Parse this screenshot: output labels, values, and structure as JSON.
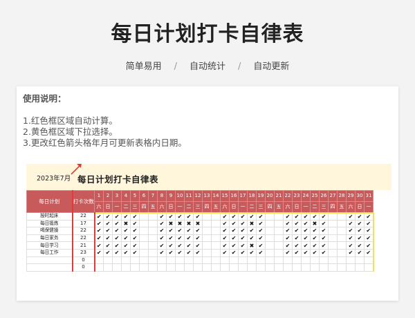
{
  "page": {
    "title": "每日计划打卡自律表",
    "features": [
      "简单易用",
      "自动统计",
      "自动更新"
    ],
    "separator": "/"
  },
  "instructions": {
    "heading": "使用说明：",
    "lines": [
      "1.红色框区域自动计算。",
      "2.黄色框区域下拉选择。",
      "3.更改红色箭头格年月可更新表格内日期。"
    ]
  },
  "sheet": {
    "year_month": "2023年7月",
    "title": "每日计划打卡自律表",
    "col_plan": "每日计划",
    "col_count": "打卡次数",
    "days": [
      "1",
      "2",
      "3",
      "4",
      "5",
      "6",
      "7",
      "8",
      "9",
      "10",
      "11",
      "12",
      "13",
      "14",
      "15",
      "16",
      "17",
      "18",
      "19",
      "20",
      "21",
      "22",
      "23",
      "24",
      "25",
      "26",
      "27",
      "28",
      "29",
      "30",
      "31"
    ],
    "weekdays": [
      "六",
      "日",
      "一",
      "二",
      "三",
      "四",
      "五",
      "六",
      "日",
      "一",
      "二",
      "三",
      "四",
      "五",
      "六",
      "日",
      "一",
      "二",
      "三",
      "四",
      "五",
      "六",
      "日",
      "一",
      "二",
      "三",
      "四",
      "五",
      "六",
      "日",
      "一"
    ],
    "rows": [
      {
        "name": "按时起床",
        "count": "22",
        "marks": "✔,✔,✔,✔,✔,,,✔,✔,✔,✔,✔,,,✔,✔,✔,✔,✔,,,✔,✔,✔,✔,✔,,,✔,✔,✔"
      },
      {
        "name": "每日锻炼",
        "count": "17",
        "marks": "✔,✔,✔,✖,✔,,,✔,✖,✖,✖,✖,,,✔,✔,✔,✖,✔,,,✔,✔,✔,✖,✔,,,✔,✔,✔"
      },
      {
        "name": "喝保健操",
        "count": "22",
        "marks": "✔,✔,✔,✔,✔,,,✔,✔,✔,✔,✔,,,✔,✔,✔,✔,✔,,,✔,✔,✔,✔,✔,,,✔,✔,✔"
      },
      {
        "name": "每日家务",
        "count": "22",
        "marks": "✔,✔,✔,✔,✔,,,✔,✔,✔,✔,✔,,,✔,✔,✔,✔,✔,,,✔,✔,✔,✔,✔,,,✔,✔,✔"
      },
      {
        "name": "每日学习",
        "count": "21",
        "marks": "✔,✔,✔,✔,✔,,,✔,✔,✔,✔,✔,,,✔,✔,✔,✖,✔,,,✔,✔,✔,✔,✔,,,✔,✔,✔"
      },
      {
        "name": "每日工作",
        "count": "23",
        "marks": "✔,✔,✔,✔,✔,,,✔,✔,✔,✔,✔,,,✔,✔,✔,✔,✔,,,✔,✔,✔,✔,✔,,,✔,✔,✔"
      },
      {
        "name": "",
        "count": "0",
        "marks": ""
      },
      {
        "name": "",
        "count": "0",
        "marks": ""
      }
    ]
  },
  "colors": {
    "header_red": "#c85a5c",
    "red_border": "#e53935",
    "yellow_border": "#f3e15a",
    "sheet_top_bg": "#fff6dc"
  }
}
